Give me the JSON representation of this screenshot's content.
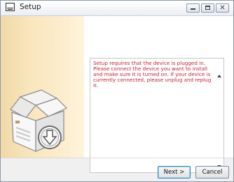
{
  "window": {
    "title": "Setup",
    "controls": {
      "minimize": "minimize",
      "maximize": "maximize",
      "close": "✕"
    }
  },
  "message": {
    "text": "Setup requires that the device is plugged in. Please connect the device you want to install and make sure it is turned on. If your device is currently connected, please unplug and replug it."
  },
  "buttons": {
    "next": "Next >",
    "cancel": "Cancel"
  },
  "colors": {
    "message_text": "#c8202a",
    "sidebar": "#f8e4b8"
  }
}
